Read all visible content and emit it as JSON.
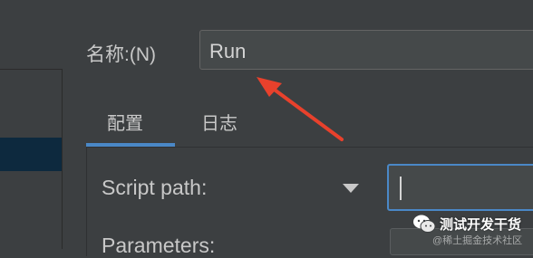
{
  "dialog": {
    "name_label": "名称:(N)",
    "name_value": "Run",
    "tabs": [
      {
        "label": "配置",
        "selected": true
      },
      {
        "label": "日志",
        "selected": false
      }
    ],
    "script_path_label": "Script path:",
    "script_path_value": "",
    "parameters_label": "Parameters:"
  },
  "watermark": {
    "main": "测试开发干货",
    "sub": "@稀土掘金技术社区"
  },
  "colors": {
    "background": "#3c3f41",
    "accent": "#4a88c7",
    "arrow": "#e8412c",
    "selection": "#0d293e"
  },
  "icons": [
    "dropdown-arrow-icon",
    "wechat-icon",
    "annotation-arrow-icon"
  ]
}
